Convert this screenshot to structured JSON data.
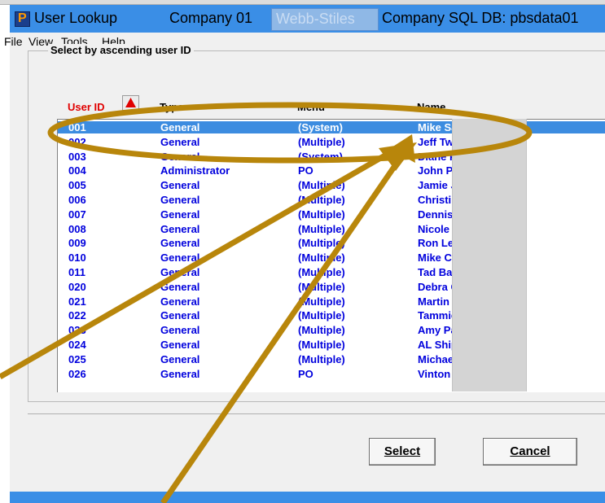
{
  "titlebar": {
    "app_title": "User Lookup",
    "company": "Company 01",
    "company_name": "Webb-Stiles",
    "db": "Company SQL DB: pbsdata01"
  },
  "menu": [
    "File",
    "View",
    "Tools",
    "Help"
  ],
  "group_label": "Select by ascending user ID",
  "columns": {
    "userid": "User ID",
    "type": "Type",
    "menu": "Menu",
    "name": "Name"
  },
  "sort_indicator": "up-arrow-icon",
  "selected_row": 0,
  "rows": [
    {
      "id": "001",
      "type": "General",
      "menu": "(System)",
      "name": "Mike Salaciak"
    },
    {
      "id": "002",
      "type": "General",
      "menu": "(Multiple)",
      "name": "Jeff Twardak"
    },
    {
      "id": "003",
      "type": "General",
      "menu": "(System)",
      "name": "Diane Philpot"
    },
    {
      "id": "004",
      "type": "Administrator",
      "menu": "PO",
      "name": "John Pawluk"
    },
    {
      "id": "005",
      "type": "General",
      "menu": "(Multiple)",
      "name": "Jamie Jonscher"
    },
    {
      "id": "006",
      "type": "General",
      "menu": "(Multiple)",
      "name": "Christine DuBetz"
    },
    {
      "id": "007",
      "type": "General",
      "menu": "(Multiple)",
      "name": "Dennis Smith"
    },
    {
      "id": "008",
      "type": "General",
      "menu": "(Multiple)",
      "name": "Nicole Salaciak"
    },
    {
      "id": "009",
      "type": "General",
      "menu": "(Multiple)",
      "name": "Ron Lee Jr"
    },
    {
      "id": "010",
      "type": "General",
      "menu": "(Multiple)",
      "name": "Mike Castello"
    },
    {
      "id": "011",
      "type": "General",
      "menu": "(Multiple)",
      "name": "Tad Bartlett"
    },
    {
      "id": "020",
      "type": "General",
      "menu": "(Multiple)",
      "name": "Debra Gunter"
    },
    {
      "id": "021",
      "type": "General",
      "menu": "(Multiple)",
      "name": "Martin Gable"
    },
    {
      "id": "022",
      "type": "General",
      "menu": "(Multiple)",
      "name": "Tammie Carroll"
    },
    {
      "id": "023",
      "type": "General",
      "menu": "(Multiple)",
      "name": "Amy Patterson"
    },
    {
      "id": "024",
      "type": "General",
      "menu": "(Multiple)",
      "name": "AL Shipping"
    },
    {
      "id": "025",
      "type": "General",
      "menu": "(Multiple)",
      "name": "Michael Davis"
    },
    {
      "id": "026",
      "type": "General",
      "menu": "PO",
      "name": "Vinton Bair"
    }
  ],
  "buttons": {
    "select": "Select",
    "cancel": "Cancel"
  },
  "colors": {
    "title_blue": "#3a8ee6",
    "list_text": "#0000dd",
    "header_sorted": "#e00000",
    "selection": "#3c8ce0",
    "annotation": "#b8860b"
  }
}
